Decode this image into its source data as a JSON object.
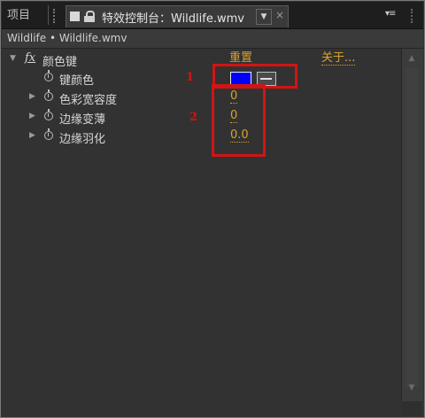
{
  "tabs": {
    "project": "项目",
    "effect_controls": "特效控制台：Wildlife.wmv",
    "dropdown": "▼",
    "close": "×",
    "menu": "▾≡"
  },
  "clip": {
    "label": "Wildlife • Wildlife.wmv"
  },
  "effect": {
    "fx": "fx",
    "name": "颜色键",
    "reset": "重置",
    "about": "关于..."
  },
  "properties": [
    {
      "label": "键颜色",
      "value": null,
      "color": "#0000ff"
    },
    {
      "label": "色彩宽容度",
      "value": "0"
    },
    {
      "label": "边缘变薄",
      "value": "0"
    },
    {
      "label": "边缘羽化",
      "value": "0.0"
    }
  ],
  "annotations": {
    "one": "1",
    "two": "2"
  },
  "colors": {
    "accent": "#d9a22a",
    "annotation": "#d21414",
    "key_color": "#0000ff"
  }
}
